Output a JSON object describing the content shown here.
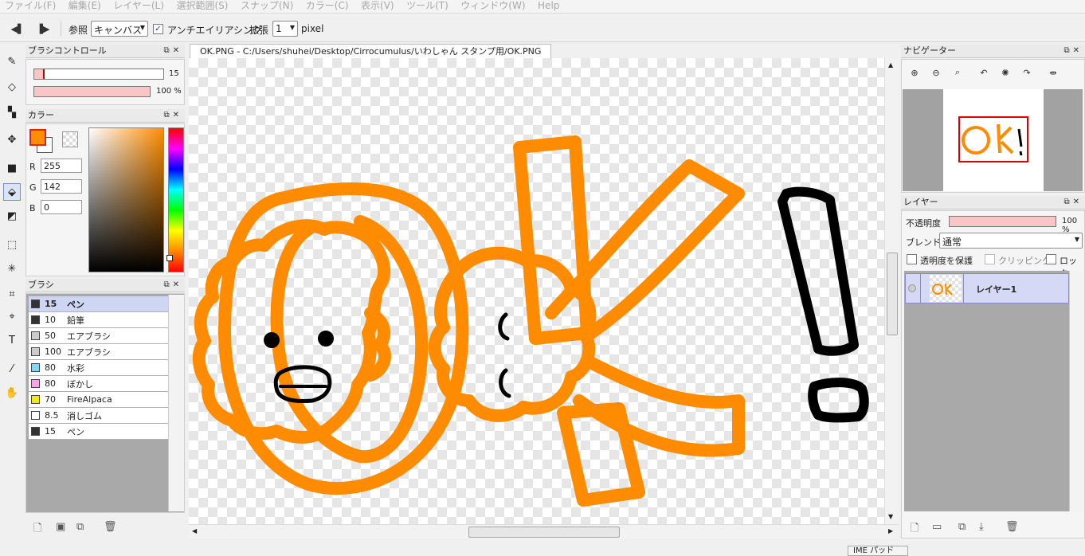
{
  "menubar": {
    "items": [
      "ファイル(F)",
      "編集(E)",
      "レイヤー(L)",
      "選択範囲(S)",
      "スナップ(N)",
      "カラー(C)",
      "表示(V)",
      "ツール(T)",
      "ウィンドウ(W)",
      "Help"
    ]
  },
  "toolbar": {
    "ref_label": "参照",
    "ref_value": "キャンバス",
    "antialias_label": "アンチエイリアシング",
    "antialias_checked": true,
    "expand_label": "拡張",
    "expand_value": "1",
    "unit_label": "pixel"
  },
  "brush_control": {
    "title": "ブラシコントロール",
    "size_value": "15",
    "size_fraction": 0.08,
    "opacity_value": "100 %",
    "opacity_fraction": 1.0
  },
  "color_panel": {
    "title": "カラー",
    "foreground": "#ff8e00",
    "r_label": "R",
    "r_value": "255",
    "g_label": "G",
    "g_value": "142",
    "b_label": "B",
    "b_value": "0"
  },
  "brush_panel": {
    "title": "ブラシ",
    "items": [
      {
        "size": "15",
        "name": "ペン",
        "color": "#333333",
        "selected": true
      },
      {
        "size": "10",
        "name": "鉛筆",
        "color": "#333333",
        "selected": false
      },
      {
        "size": "50",
        "name": "エアブラシ",
        "color": "#cccccc",
        "selected": false
      },
      {
        "size": "100",
        "name": "エアブラシ",
        "color": "#cccccc",
        "selected": false
      },
      {
        "size": "80",
        "name": "水彩",
        "color": "#7fd8f4",
        "selected": false
      },
      {
        "size": "80",
        "name": "ぼかし",
        "color": "#f6a5e9",
        "selected": false
      },
      {
        "size": "70",
        "name": "FireAlpaca",
        "color": "#f0e81e",
        "selected": false
      },
      {
        "size": "8.5",
        "name": "消しゴム",
        "color": "#ffffff",
        "selected": false
      },
      {
        "size": "15",
        "name": "ペン",
        "color": "#333333",
        "selected": false
      }
    ]
  },
  "canvas": {
    "tab_title": "OK.PNG - C:/Users/shuhei/Desktop/Cirrocumulus/いわしゃん スタンプ用/OK.PNG",
    "stroke_orange": "#ff8c00",
    "stroke_black": "#000000"
  },
  "navigator": {
    "title": "ナビゲーター"
  },
  "layer_panel": {
    "title": "レイヤー",
    "opacity_label": "不透明度",
    "opacity_value": "100 %",
    "opacity_fraction": 1.0,
    "blend_label": "ブレンド",
    "blend_value": "通常",
    "protect_alpha_label": "透明度を保護",
    "clipping_label": "クリッピング",
    "lock_label": "ロック",
    "layers": [
      {
        "name": "レイヤー1",
        "selected": true
      }
    ]
  },
  "ime": {
    "label": "IME パッド"
  }
}
